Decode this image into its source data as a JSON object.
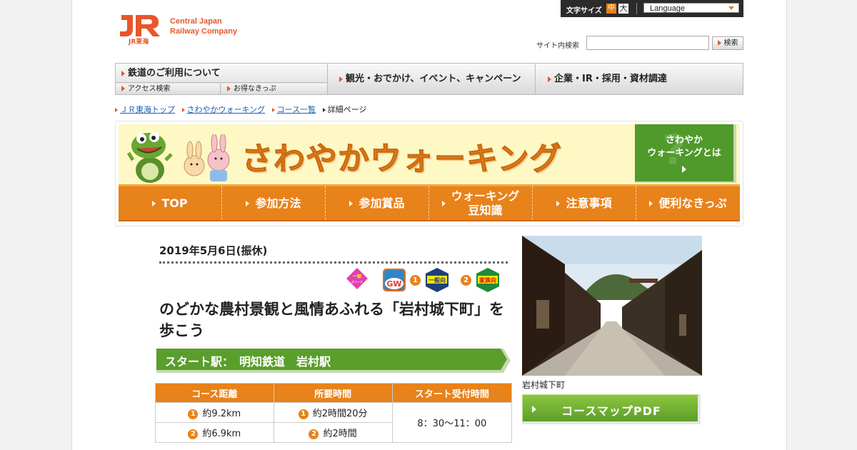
{
  "header": {
    "logo_mark": "JR",
    "logo_sub": "JR東海",
    "logo_line1": "Central Japan",
    "logo_line2": "Railway Company",
    "font_size_label": "文字サイズ",
    "font_size_medium": "中",
    "font_size_large": "大",
    "language_label": "Language",
    "search_label": "サイト内検索",
    "search_value": "",
    "search_button": "検索"
  },
  "main_nav": {
    "rail_label": "鉄道のご利用について",
    "rail_sub1": "アクセス検索",
    "rail_sub2": "お得なきっぷ",
    "item2": "観光・おでかけ、イベント、キャンペーン",
    "item3": "企業・IR・採用・資材調達"
  },
  "breadcrumb": {
    "items": [
      "ＪＲ東海トップ",
      "さわやかウォーキング",
      "コース一覧"
    ],
    "current": "詳細ページ"
  },
  "banner": {
    "title": "さわやかウォーキング",
    "about_line1": "さわやか",
    "about_line2": "ウォーキングとは",
    "menu": [
      "TOP",
      "参加方法",
      "参加賞品",
      "ウォーキング",
      "豆知識",
      "注意事項",
      "便利なきっぷ"
    ]
  },
  "event": {
    "date": "2019年5月6日(振休)",
    "badge_partial_line1": "一部",
    "badge_partial_line2": "歩コース",
    "badge_gw": "GW",
    "badge_num1": "1",
    "badge_general": "一般向",
    "badge_num2": "2",
    "badge_family": "家族向",
    "title": "のどかな農村景観と風情あふれる「岩村城下町」を歩こう",
    "start_station": "スタート駅：　明知鉄道　岩村駅"
  },
  "table": {
    "headers": [
      "コース距離",
      "所要時間",
      "スタート受付時間"
    ],
    "rows": [
      {
        "num": "1",
        "distance": "約9.2km",
        "duration": "約2時間20分"
      },
      {
        "num": "2",
        "distance": "約6.9km",
        "duration": "約2時間"
      }
    ],
    "reception_time": "8：30～11：00"
  },
  "photo": {
    "caption": "岩村城下町"
  },
  "map_button": "コースマップPDF",
  "colors": {
    "jr_orange": "#e8562a",
    "walking_orange": "#e8821a",
    "walking_green": "#4f9a2a"
  }
}
